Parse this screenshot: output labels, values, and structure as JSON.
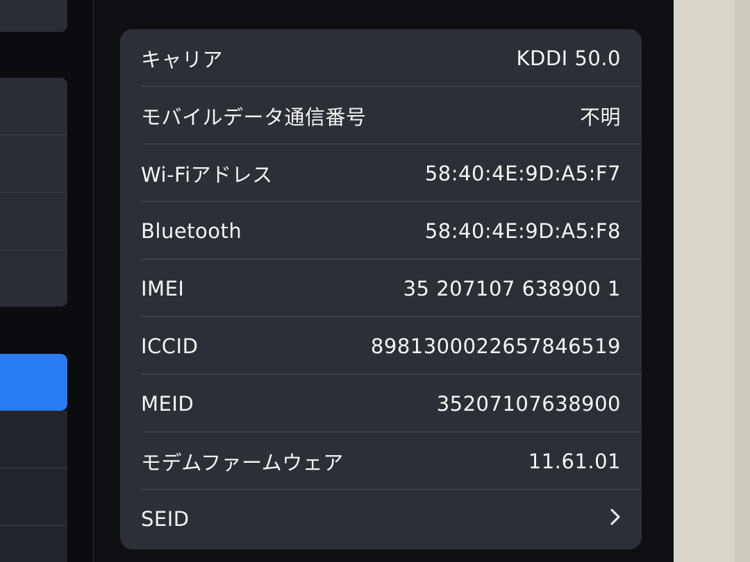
{
  "about": {
    "rows": [
      {
        "label": "キャリア",
        "value": "KDDI 50.0"
      },
      {
        "label": "モバイルデータ通信番号",
        "value": "不明"
      },
      {
        "label": "Wi-Fiアドレス",
        "value": "58:40:4E:9D:A5:F7"
      },
      {
        "label": "Bluetooth",
        "value": "58:40:4E:9D:A5:F8"
      },
      {
        "label": "IMEI",
        "value": "35 207107 638900 1"
      },
      {
        "label": "ICCID",
        "value": "8981300022657846519"
      },
      {
        "label": "MEID",
        "value": "35207107638900"
      },
      {
        "label": "モデムファームウェア",
        "value": "11.61.01"
      },
      {
        "label": "SEID",
        "chevron": "chevron-right-icon"
      }
    ]
  },
  "colors": {
    "card_bg": "#2c3036",
    "separator": "#4a4e56",
    "text": "#f4f5f7",
    "sidebar_selected": "#2a7cf2"
  }
}
